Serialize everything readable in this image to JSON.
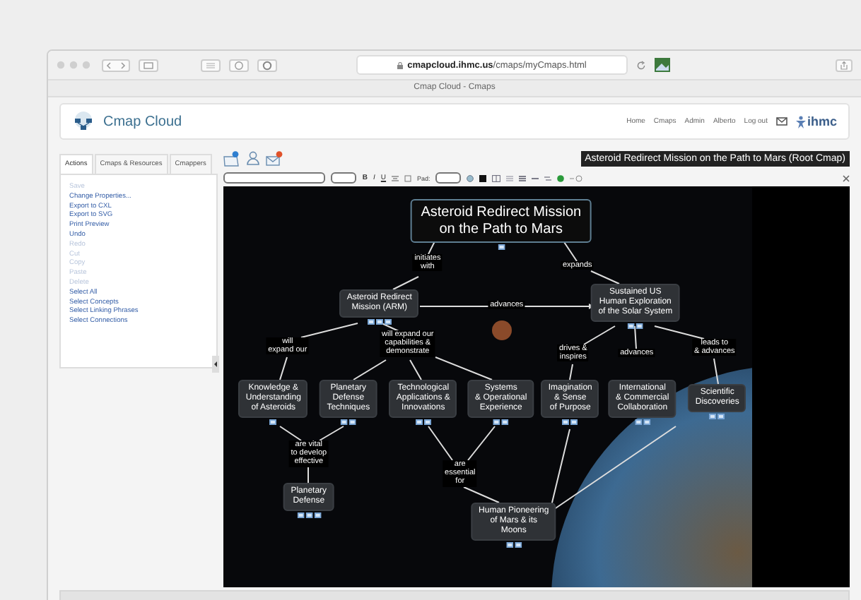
{
  "browser": {
    "url_domain": "cmapcloud.ihmc.us",
    "url_path": "/cmaps/myCmaps.html",
    "tab_title": "Cmap Cloud - Cmaps"
  },
  "header": {
    "logo": "Cmap Cloud",
    "nav": [
      "Home",
      "Cmaps",
      "Admin",
      "Alberto",
      "Log out"
    ],
    "brand": "ihmc"
  },
  "side_panel": {
    "tabs": [
      {
        "label": "Actions",
        "selected": true
      },
      {
        "label": "Cmaps & Resources",
        "selected": false
      },
      {
        "label": "Cmappers",
        "selected": false
      }
    ],
    "actions": [
      {
        "label": "Save",
        "disabled": true
      },
      {
        "label": "Change Properties...",
        "disabled": false
      },
      {
        "label": "Export to CXL",
        "disabled": false
      },
      {
        "label": "Export to SVG",
        "disabled": false
      },
      {
        "label": "Print Preview",
        "disabled": false
      },
      {
        "label": "Undo",
        "disabled": false
      },
      {
        "label": "Redo",
        "disabled": true
      },
      {
        "label": "Cut",
        "disabled": true
      },
      {
        "label": "Copy",
        "disabled": true
      },
      {
        "label": "Paste",
        "disabled": true
      },
      {
        "label": "Delete",
        "disabled": true
      },
      {
        "label": "Select All",
        "disabled": false
      },
      {
        "label": "Select Concepts",
        "disabled": false
      },
      {
        "label": "Select Linking Phrases",
        "disabled": false
      },
      {
        "label": "Select Connections",
        "disabled": false
      }
    ]
  },
  "editor": {
    "tooltip": "Asteroid Redirect Mission on the Path to Mars (Root Cmap)",
    "toolbar": {
      "format_buttons": [
        "B",
        "I",
        "U"
      ],
      "pad_label": "Pad:"
    },
    "concept_map": {
      "concepts": [
        {
          "kind": "root",
          "text": "Asteroid Redirect Mission\non the Path to Mars"
        },
        {
          "kind": "concept",
          "text": "Asteroid Redirect\nMission (ARM)"
        },
        {
          "kind": "concept",
          "text": "Sustained US\nHuman Exploration\nof the Solar System"
        },
        {
          "kind": "concept",
          "text": "Knowledge &\nUnderstanding\nof Asteroids"
        },
        {
          "kind": "concept",
          "text": "Planetary\nDefense\nTechniques"
        },
        {
          "kind": "concept",
          "text": "Technological\nApplications &\nInnovations"
        },
        {
          "kind": "concept",
          "text": "Systems\n& Operational\nExperience"
        },
        {
          "kind": "concept",
          "text": "Imagination\n& Sense\nof Purpose"
        },
        {
          "kind": "concept",
          "text": "International\n& Commercial\nCollaboration"
        },
        {
          "kind": "concept",
          "text": "Scientific\nDiscoveries"
        },
        {
          "kind": "concept",
          "text": "Planetary\nDefense"
        },
        {
          "kind": "concept",
          "text": "Human Pioneering\nof Mars & its\nMoons"
        }
      ],
      "linking_phrases": [
        "initiates\nwith",
        "expands",
        "advances",
        "will\nexpand our",
        "will expand our\ncapabilities &\ndemonstrate",
        "drives &\ninspires",
        "advances",
        "leads to\n& advances",
        "are vital\nto develop\neffective",
        "are\nessential\nfor"
      ]
    }
  }
}
